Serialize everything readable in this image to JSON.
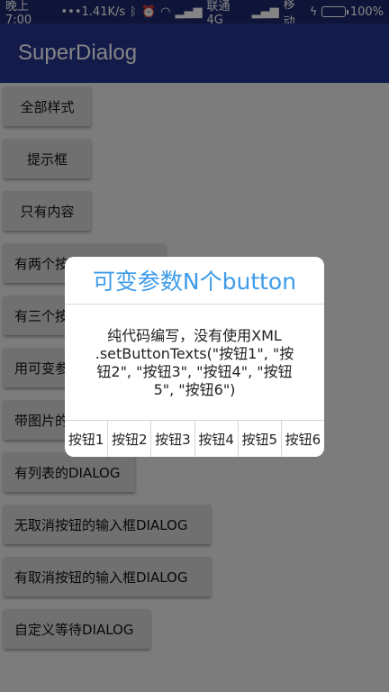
{
  "status_bar": {
    "time": "晚上7:00",
    "dots": "•••",
    "speed": "1.41K/s",
    "carrier1": "联通 4G",
    "carrier2": "移动",
    "battery": "100%"
  },
  "app_bar": {
    "title": "SuperDialog"
  },
  "buttons": [
    "全部样式",
    "提示框",
    "只有内容",
    "有两个按钮的DIALOG",
    "有三个按钮的DIALOG",
    "用可变参数的DIALOG",
    "带图片的DIALOG",
    "有列表的DIALOG",
    "无取消按钮的输入框DIALOG",
    "有取消按钮的输入框DIALOG",
    "自定义等待DIALOG"
  ],
  "dialog": {
    "title": "可变参数N个button",
    "message": "纯代码编写，没有使用XML .setButtonTexts(\"按钮1\", \"按钮2\", \"按钮3\", \"按钮4\", \"按钮5\", \"按钮6\")",
    "buttons": [
      "按钮1",
      "按钮2",
      "按钮3",
      "按钮4",
      "按钮5",
      "按钮6"
    ]
  },
  "colors": {
    "status_bar": "#1d2a6b",
    "app_bar": "#23348f",
    "dialog_title": "#3d9be9"
  }
}
